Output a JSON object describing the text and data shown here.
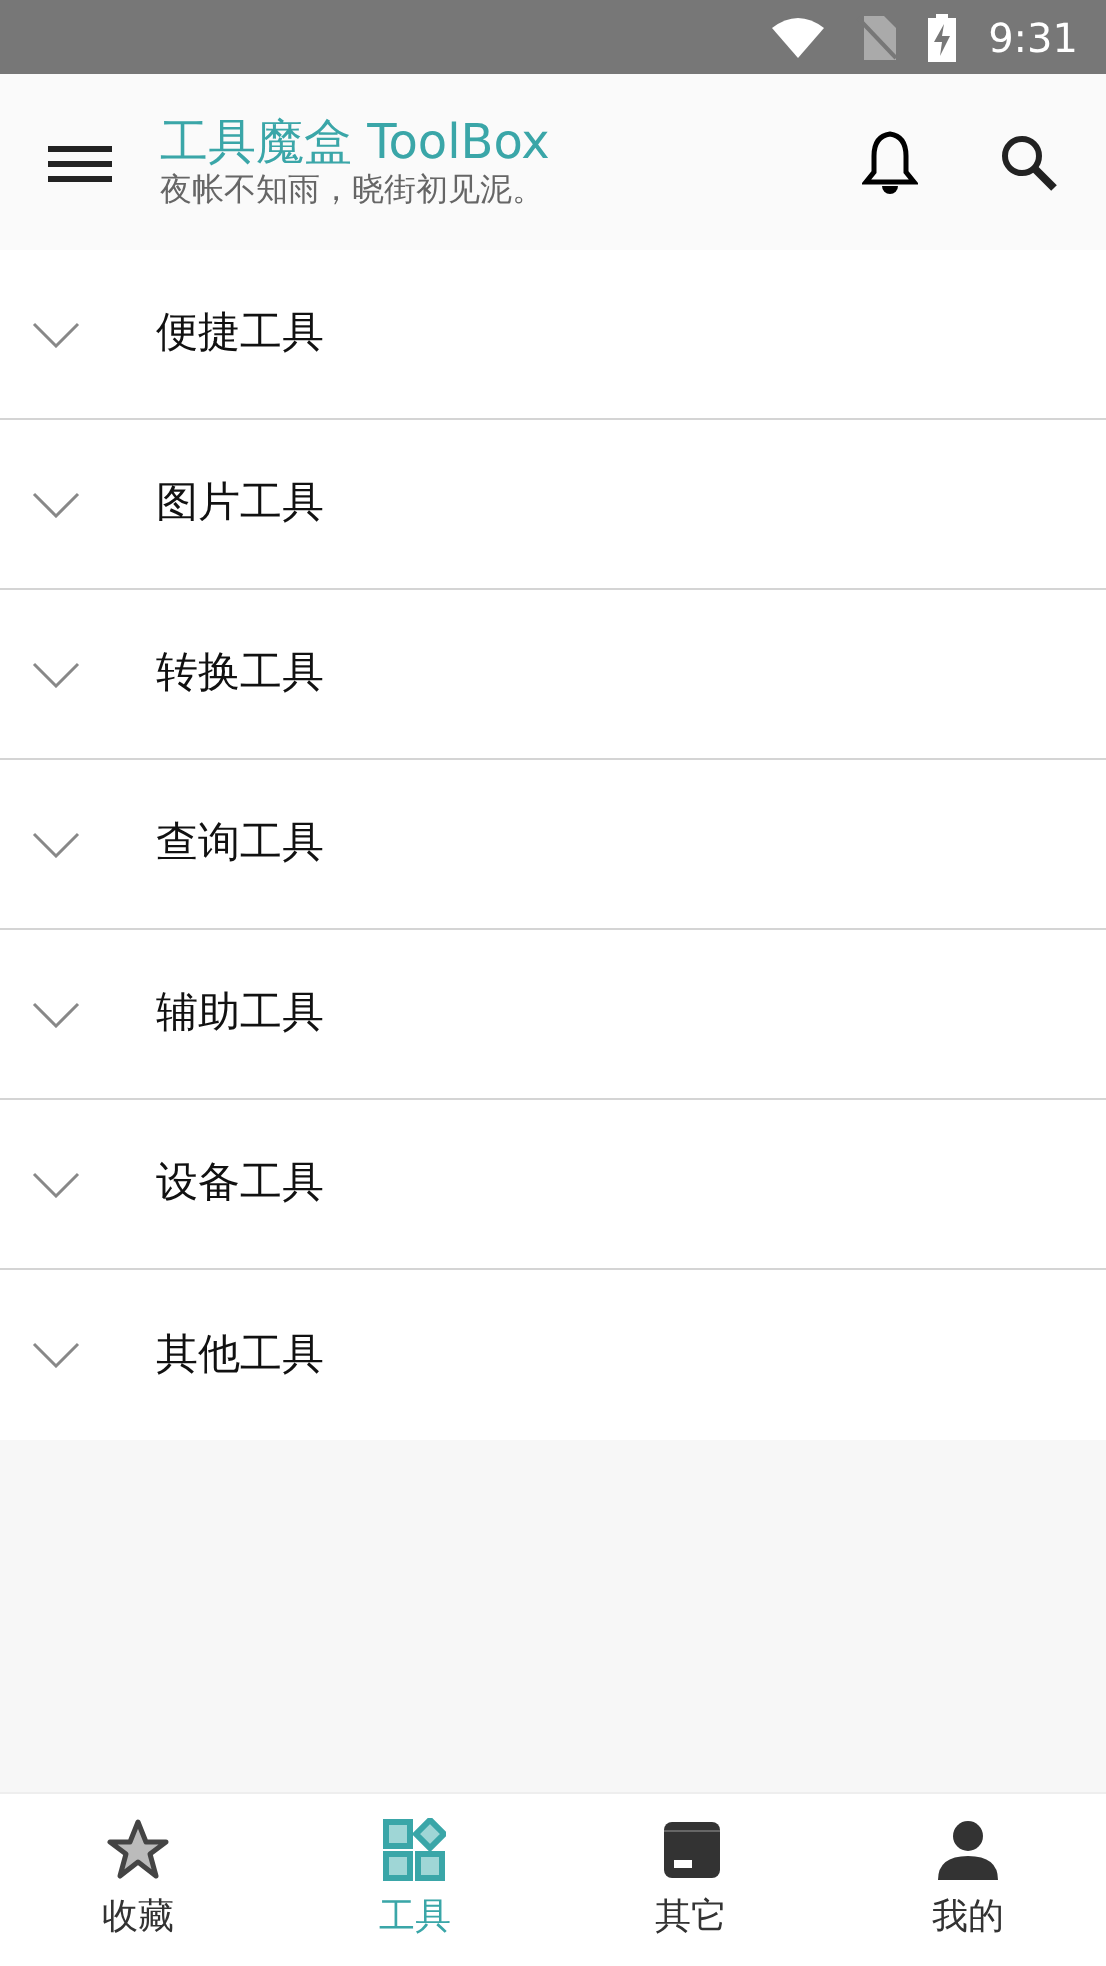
{
  "status_bar": {
    "time": "9:31"
  },
  "app_bar": {
    "title": "工具魔盒 ToolBox",
    "subtitle": "夜帐不知雨，晓街初见泥。"
  },
  "categories": [
    {
      "label": "便捷工具",
      "expanded": false
    },
    {
      "label": "图片工具",
      "expanded": false
    },
    {
      "label": "转换工具",
      "expanded": false
    },
    {
      "label": "查询工具",
      "expanded": false
    },
    {
      "label": "辅助工具",
      "expanded": false
    },
    {
      "label": "设备工具",
      "expanded": false
    },
    {
      "label": "其他工具",
      "expanded": false
    }
  ],
  "bottom_nav": [
    {
      "kind": "star",
      "label": "收藏",
      "selected": false
    },
    {
      "kind": "grid",
      "label": "工具",
      "selected": true
    },
    {
      "kind": "box",
      "label": "其它",
      "selected": false
    },
    {
      "kind": "person",
      "label": "我的",
      "selected": false
    }
  ]
}
